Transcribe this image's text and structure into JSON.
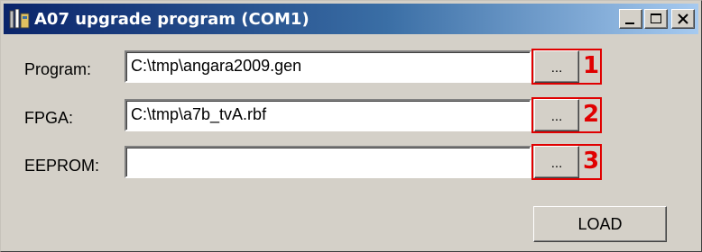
{
  "window": {
    "title": "A07 upgrade program (COM1)"
  },
  "fields": [
    {
      "label": "Program:",
      "value": "C:\\tmp\\angara2009.gen",
      "browse_label": "...",
      "marker": "1"
    },
    {
      "label": "FPGA:",
      "value": "C:\\tmp\\a7b_tvA.rbf",
      "browse_label": "...",
      "marker": "2"
    },
    {
      "label": "EEPROM:",
      "value": "",
      "browse_label": "...",
      "marker": "3"
    }
  ],
  "actions": {
    "load_label": "LOAD"
  },
  "colors": {
    "titlebar_start": "#0a246a",
    "titlebar_end": "#a6caf0",
    "face": "#d4d0c8",
    "marker": "#e00000"
  }
}
